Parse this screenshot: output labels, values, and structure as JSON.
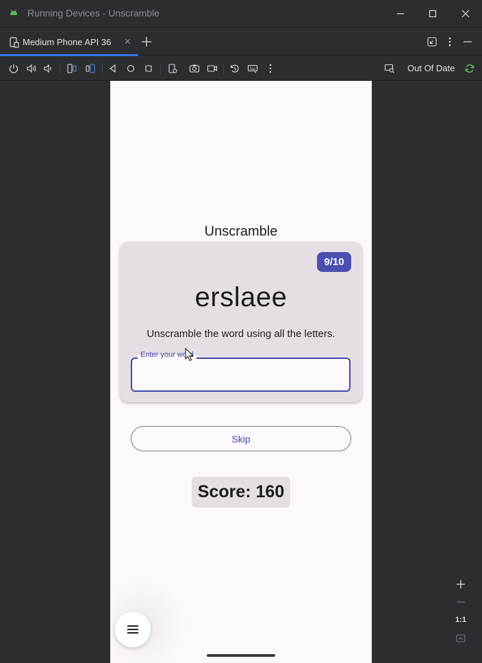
{
  "window": {
    "title": "Running Devices - Unscramble",
    "minimize_icon": "minimize-icon",
    "maximize_icon": "maximize-icon",
    "close_icon": "close-icon"
  },
  "tabs": [
    {
      "label": "Medium Phone API 36",
      "icon": "device-mirror-icon",
      "active": true
    }
  ],
  "tabbar": {
    "add_icon": "plus-icon",
    "collapse_icon": "collapse-icon",
    "more_icon": "more-vertical-icon",
    "hide_icon": "minimize-icon"
  },
  "toolbar": {
    "items": [
      "power-icon",
      "volume-up-icon",
      "volume-down-icon",
      "rotate-left-icon",
      "rotate-right-icon",
      "back-icon",
      "home-icon",
      "overview-icon",
      "snapshot-icon",
      "screenshot-icon",
      "screen-record-icon",
      "reset-icon",
      "keyboard-icon",
      "more-vertical-icon"
    ],
    "status_label": "Out Of Date",
    "status_icons": [
      "device-search-icon",
      "refresh-icon"
    ]
  },
  "app": {
    "title": "Unscramble",
    "word_count": "9/10",
    "scrambled_word": "erslaee",
    "instructions": "Unscramble the word using all the letters.",
    "input": {
      "label": "Enter your word",
      "value": ""
    },
    "skip_label": "Skip",
    "score": "Score: 160",
    "fab_icon": "menu-icon"
  },
  "zoom": {
    "zoom_in_icon": "plus-icon",
    "zoom_out_icon": "minus-icon",
    "ratio": "1:1",
    "fit_icon": "fit-screen-icon"
  },
  "colors": {
    "ide_background": "#2b2d30",
    "accent": "#3574f0",
    "app_primary": "#4a4fb0",
    "card": "#e5dfe5",
    "screen": "#fdf8fc",
    "sync_green": "#5fb85f"
  }
}
